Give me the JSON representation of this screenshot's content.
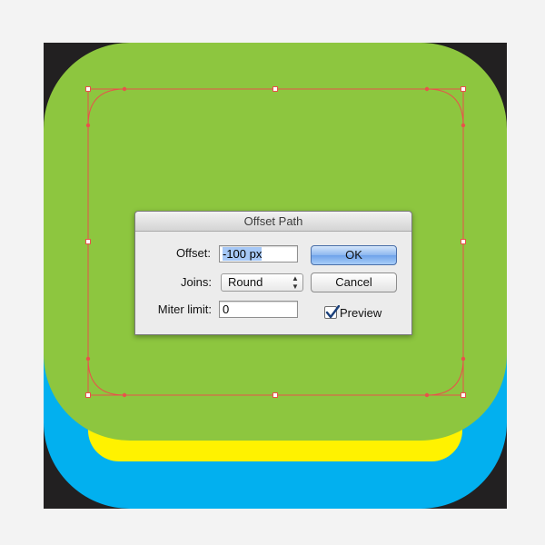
{
  "dialog": {
    "title": "Offset Path",
    "offset": {
      "label": "Offset:",
      "value": "-100 px"
    },
    "joins": {
      "label": "Joins:",
      "value": "Round"
    },
    "miter_limit": {
      "label": "Miter limit:",
      "value": "0"
    },
    "ok_label": "OK",
    "cancel_label": "Cancel",
    "preview": {
      "label": "Preview",
      "checked": true
    }
  },
  "icons": {
    "select_arrows": "updown-arrows-icon",
    "preview_check": "checkmark-icon"
  },
  "colors": {
    "artboard_background": "#222021",
    "outer_shape": "#02b0ef",
    "middle_shape": "#fff200",
    "top_shape": "#8dc63f",
    "selection_path": "#e8524b",
    "ok_button": "#6ea3ea"
  }
}
